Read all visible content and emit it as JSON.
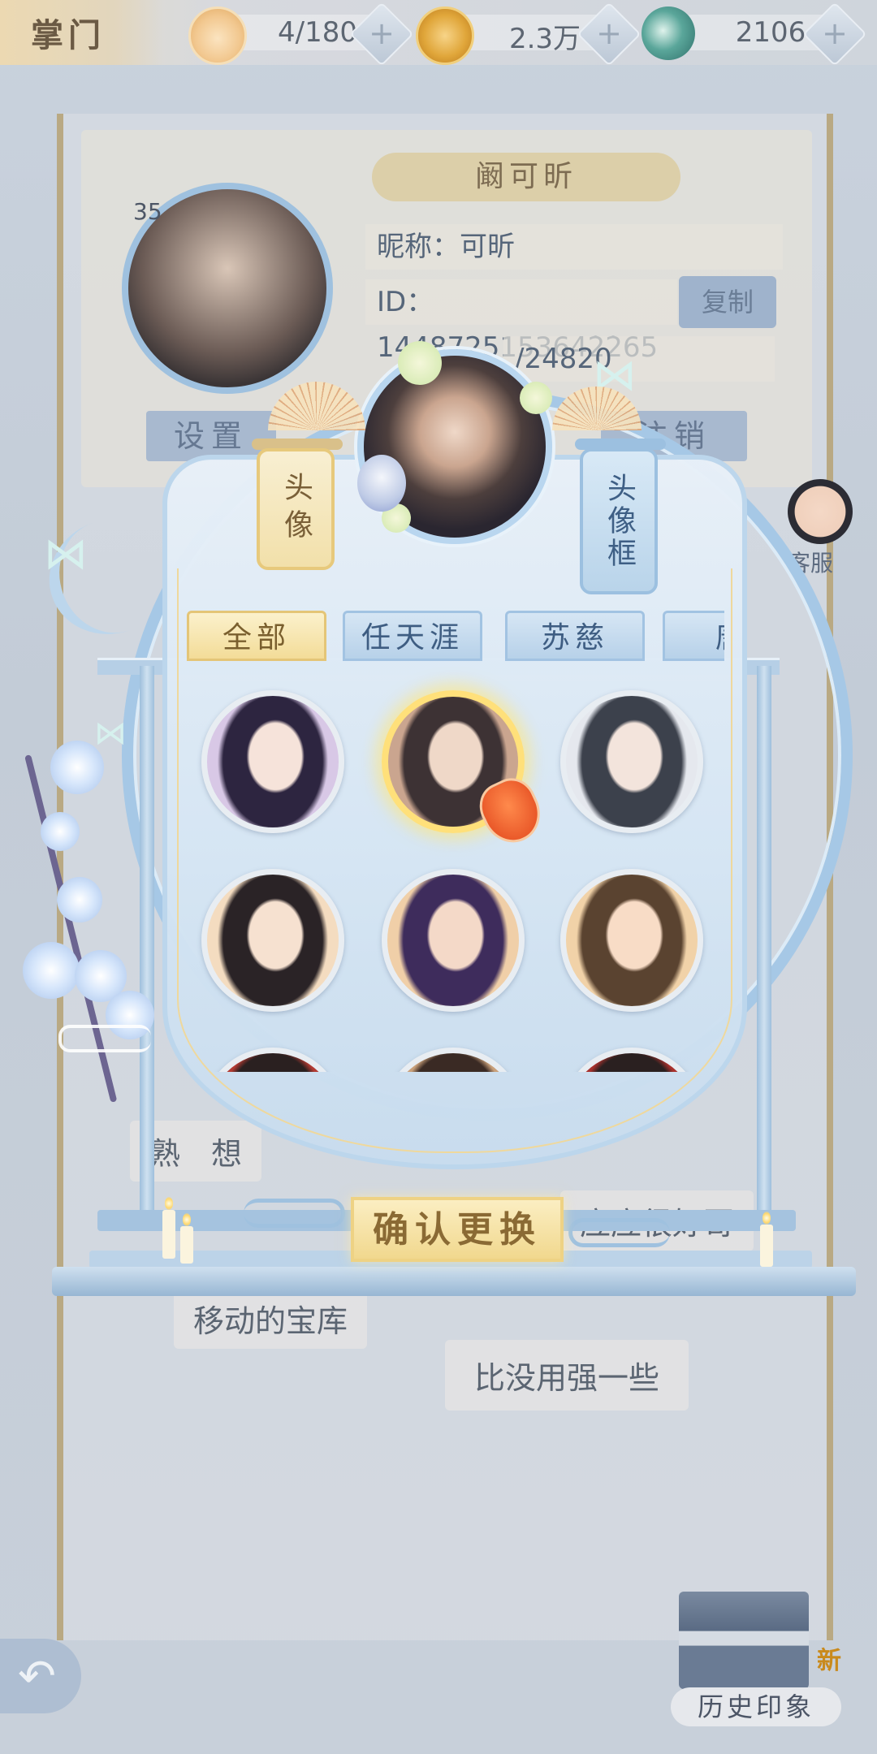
{
  "topbar": {
    "title": "掌门",
    "resources": [
      {
        "icon": "cat-face-icon",
        "value": "4/180",
        "plus": "+"
      },
      {
        "icon": "gold-coin-icon",
        "value": "2.3万",
        "plus": "+"
      },
      {
        "icon": "jade-dragon-icon",
        "value": "2106",
        "plus": "+"
      }
    ]
  },
  "profile": {
    "name": "阚可昕",
    "nickname": "昵称：可昕",
    "id_text": "ID：1448725153642265​13",
    "copy_label": "复制",
    "exp_text": "/24820",
    "level": "35",
    "settings_label": "设置",
    "logout_label": "注销",
    "service_label": "客服"
  },
  "background_texts": {
    "line1": "熟",
    "line1b": "想",
    "line2": "应应很好哥",
    "line3": "移动的宝库",
    "line4": "比没用强一些",
    "history_label": "历史印象",
    "history_new": "新"
  },
  "picker": {
    "avatar_scroll": "头像",
    "frame_scroll": "头像框",
    "tabs": [
      "全部",
      "任天涯",
      "苏慈",
      "唐"
    ],
    "active_tab": 0,
    "confirm_label": "确认更换",
    "portraits": [
      {
        "name": "portrait-1",
        "selected": false,
        "bg": "#d8c8e6",
        "hair": "#2d2540",
        "skin": "#f6e3da"
      },
      {
        "name": "portrait-2",
        "selected": true,
        "bg": "#caa58f",
        "hair": "#3d3234",
        "skin": "#efd8c8"
      },
      {
        "name": "portrait-3",
        "selected": false,
        "bg": "#e5e8ee",
        "hair": "#3c414c",
        "skin": "#f3e4dc"
      },
      {
        "name": "portrait-4",
        "selected": false,
        "bg": "#f4dcc0",
        "hair": "#2a2326",
        "skin": "#f6e1d0"
      },
      {
        "name": "portrait-5",
        "selected": false,
        "bg": "#f0cfa8",
        "hair": "#3e2c5c",
        "skin": "#f4d9c8"
      },
      {
        "name": "portrait-6",
        "selected": false,
        "bg": "#f1d2a8",
        "hair": "#5a4330",
        "skin": "#f8dcc6"
      },
      {
        "name": "portrait-7",
        "selected": false,
        "bg": "#b23a32",
        "hair": "#2a2020",
        "skin": "#f0d0c0"
      },
      {
        "name": "portrait-8",
        "selected": false,
        "bg": "#c9a07a",
        "hair": "#3a2a24",
        "skin": "#f0d6c4"
      },
      {
        "name": "portrait-9",
        "selected": false,
        "bg": "#a8302c",
        "hair": "#2a2020",
        "skin": "#f0d0c0"
      }
    ]
  }
}
